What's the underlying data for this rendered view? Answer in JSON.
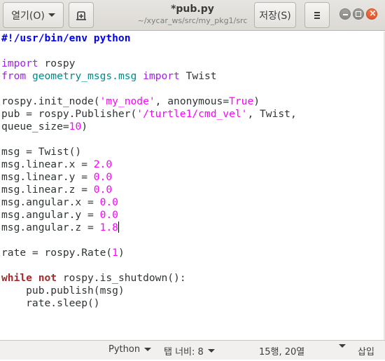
{
  "header": {
    "open_label": "열기(O)",
    "title": "*pub.py",
    "subtitle": "~/xycar_ws/src/my_pkg1/src",
    "save_label": "저장(S)"
  },
  "code_lines": [
    [
      {
        "t": "#!/usr/bin/env python",
        "c": "shebang"
      }
    ],
    [],
    [
      {
        "t": "import",
        "c": "imp"
      },
      {
        "t": " rospy",
        "c": ""
      }
    ],
    [
      {
        "t": "from",
        "c": "imp"
      },
      {
        "t": " ",
        "c": ""
      },
      {
        "t": "geometry_msgs.msg",
        "c": "mod"
      },
      {
        "t": " ",
        "c": ""
      },
      {
        "t": "import",
        "c": "imp"
      },
      {
        "t": " Twist",
        "c": ""
      }
    ],
    [],
    [
      {
        "t": "rospy.init_node(",
        "c": ""
      },
      {
        "t": "'my_node'",
        "c": "str"
      },
      {
        "t": ", anonymous=",
        "c": ""
      },
      {
        "t": "True",
        "c": "bool"
      },
      {
        "t": ")",
        "c": ""
      }
    ],
    [
      {
        "t": "pub = rospy.Publisher(",
        "c": ""
      },
      {
        "t": "'/turtle1/cmd_vel'",
        "c": "str"
      },
      {
        "t": ", Twist,",
        "c": ""
      }
    ],
    [
      {
        "t": "queue_size=",
        "c": ""
      },
      {
        "t": "10",
        "c": "num"
      },
      {
        "t": ")",
        "c": ""
      }
    ],
    [],
    [
      {
        "t": "msg = Twist()",
        "c": ""
      }
    ],
    [
      {
        "t": "msg.linear.x = ",
        "c": ""
      },
      {
        "t": "2.0",
        "c": "num"
      }
    ],
    [
      {
        "t": "msg.linear.y = ",
        "c": ""
      },
      {
        "t": "0.0",
        "c": "num"
      }
    ],
    [
      {
        "t": "msg.linear.z = ",
        "c": ""
      },
      {
        "t": "0.0",
        "c": "num"
      }
    ],
    [
      {
        "t": "msg.angular.x = ",
        "c": ""
      },
      {
        "t": "0.0",
        "c": "num"
      }
    ],
    [
      {
        "t": "msg.angular.y = ",
        "c": ""
      },
      {
        "t": "0.0",
        "c": "num"
      }
    ],
    [
      {
        "t": "msg.angular.z = ",
        "c": ""
      },
      {
        "t": "1.8",
        "c": "num"
      },
      {
        "t": "",
        "c": "cursor"
      }
    ],
    [],
    [
      {
        "t": "rate = rospy.Rate(",
        "c": ""
      },
      {
        "t": "1",
        "c": "num"
      },
      {
        "t": ")",
        "c": ""
      }
    ],
    [],
    [
      {
        "t": "while",
        "c": "kw"
      },
      {
        "t": " ",
        "c": ""
      },
      {
        "t": "not",
        "c": "kw"
      },
      {
        "t": " rospy.is_shutdown():",
        "c": ""
      }
    ],
    [
      {
        "t": "    pub.publish(msg)",
        "c": ""
      }
    ],
    [
      {
        "t": "    rate.sleep()",
        "c": ""
      }
    ]
  ],
  "statusbar": {
    "language": "Python",
    "tab_width": "탭 너비: 8",
    "position": "15행, 20열",
    "mode": "삽입"
  },
  "icons": {
    "new_tab": "new-tab-icon",
    "menu": "hamburger-menu-icon"
  }
}
